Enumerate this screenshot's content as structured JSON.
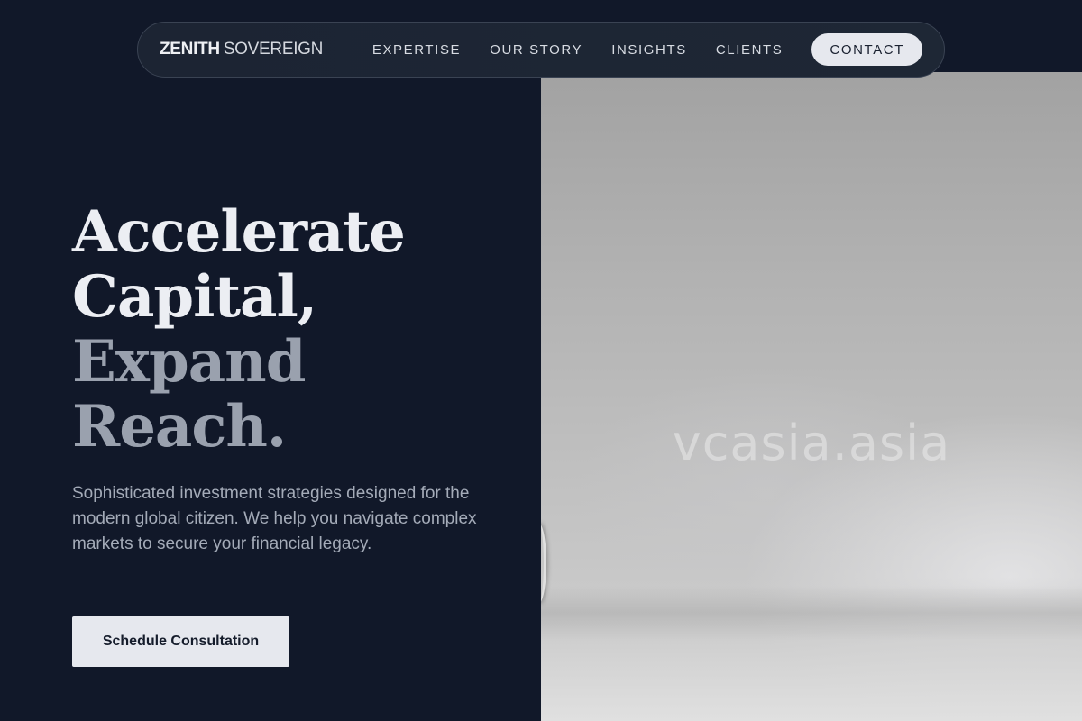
{
  "brand": {
    "strong": "ZENITH",
    "light": "SOVEREIGN"
  },
  "nav": {
    "items": [
      {
        "label": "EXPERTISE"
      },
      {
        "label": "OUR STORY"
      },
      {
        "label": "INSIGHTS"
      },
      {
        "label": "CLIENTS"
      }
    ],
    "contact_label": "CONTACT"
  },
  "hero": {
    "headline_lines": [
      "Accelerate",
      "Capital,",
      "Expand",
      "Reach."
    ],
    "description": "Sophisticated investment strategies designed for the modern global citizen. We help you navigate complex markets to secure your financial legacy.",
    "cta_label": "Schedule Consultation"
  },
  "image": {
    "watermark": "vcasia.asia"
  },
  "colors": {
    "background": "#111829",
    "headline_primary": "#eceef3",
    "headline_muted": "#9aa1ae",
    "button_bg": "#e6e8ee"
  }
}
